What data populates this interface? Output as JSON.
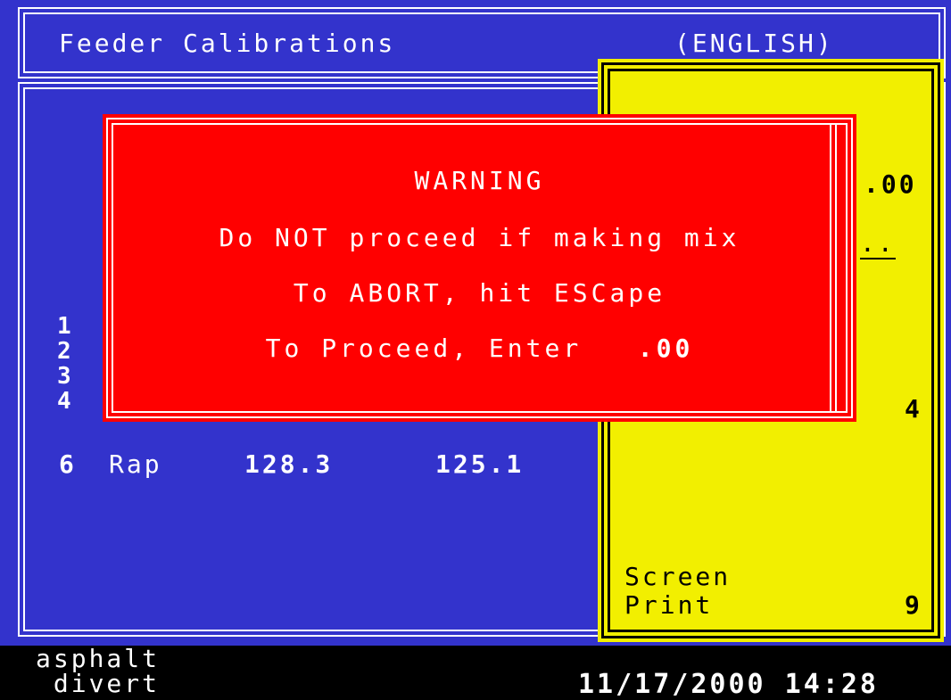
{
  "header": {
    "title": "Feeder  Calibrations",
    "language": "(ENGLISH)"
  },
  "side_rows": [
    "1",
    "2",
    "3",
    "4"
  ],
  "data_row": {
    "num": "6",
    "name": "Rap",
    "value_a": "128.3",
    "value_b": "125.1"
  },
  "yellow_panel": {
    "value_top": ".00",
    "dots": "..",
    "num_right": "4",
    "screen_label": "Screen",
    "print_label": "Print",
    "print_key": "9"
  },
  "warning_dialog": {
    "title": "WARNING",
    "line1": "Do NOT proceed if making mix",
    "line2": "To ABORT,   hit  ESCape",
    "line3_prefix": "To Proceed, Enter",
    "line3_value": ".00"
  },
  "status_bar": {
    "line1": "asphalt",
    "line2": " divert",
    "datetime": "11/17/2000 14:28"
  },
  "colors": {
    "screen_bg": "#3333cc",
    "panel_bg": "#f2ef00",
    "dialog_bg": "#ff0000",
    "status_bg": "#000000"
  }
}
